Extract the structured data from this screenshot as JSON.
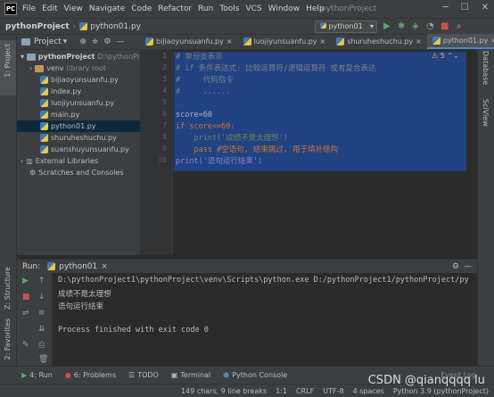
{
  "menu": {
    "items": [
      "File",
      "Edit",
      "View",
      "Navigate",
      "Code",
      "Refactor",
      "Run",
      "Tools",
      "VCS",
      "Window",
      "Help"
    ],
    "window_title": "pythonProject"
  },
  "nav": {
    "project": "pythonProject",
    "file": "python01.py",
    "run_config": "python01"
  },
  "sidebar_left": {
    "project_label": "1: Project",
    "structure_label": "Z: Structure",
    "favorites_label": "2: Favorites"
  },
  "sidebar_right": {
    "database_label": "Database",
    "sciview_label": "SciView"
  },
  "project_panel": {
    "header": "Project",
    "root": "pythonProject",
    "root_path": "D:\\pythonPr",
    "venv": "venv",
    "venv_note": "library root",
    "files": [
      "bijiaoyunsuanfu.py",
      "index.py",
      "luojiyunsuanfu.py",
      "main.py",
      "python01.py",
      "shuruheshuchu.py",
      "suanshuyunsuanfu.py"
    ],
    "external": "External Libraries",
    "scratches": "Scratches and Consoles"
  },
  "tabs": [
    "bijiaoyunsuanfu.py",
    "luojiyunsuanfu.py",
    "shuruheshuchu.py",
    "python01.py"
  ],
  "editor": {
    "warning_count": "5",
    "lines": [
      {
        "n": "1",
        "text": "# 单分支表示"
      },
      {
        "n": "2",
        "text": "# if 条件表达式: 比较运算符/逻辑运算符 或者复合表达"
      },
      {
        "n": "3",
        "text": "#     代码指令"
      },
      {
        "n": "4",
        "text": "#     ......"
      },
      {
        "n": "5",
        "text": ""
      },
      {
        "n": "6",
        "text": "score=60"
      },
      {
        "n": "7",
        "text": "if score<=60:"
      },
      {
        "n": "8",
        "text": "    print('成绩不是太理想')"
      },
      {
        "n": "9",
        "text": "    pass #空语句, 结束跳过, 用于填补结构"
      },
      {
        "n": "10",
        "text": "print('语句运行结束')"
      }
    ]
  },
  "run": {
    "label": "Run:",
    "config": "python01",
    "output": [
      "D:\\pythonProject1\\pythonProject\\venv\\Scripts\\python.exe D:/pythonProject1/pythonProject/py",
      "成绩不是太理想",
      "语句运行结束",
      "",
      "Process finished with exit code 0"
    ]
  },
  "bottom_tabs": [
    "4: Run",
    "6: Problems",
    "TODO",
    "Terminal",
    "Python Console"
  ],
  "event_log": "Event Log",
  "status": {
    "chars": "149 chars, 9 line breaks",
    "pos": "1:1",
    "crlf": "CRLF",
    "enc": "UTF-8",
    "indent": "4 spaces",
    "interp": "Python 3.9 (pythonProject)"
  },
  "watermark": "CSDN @qianqqqq lu"
}
